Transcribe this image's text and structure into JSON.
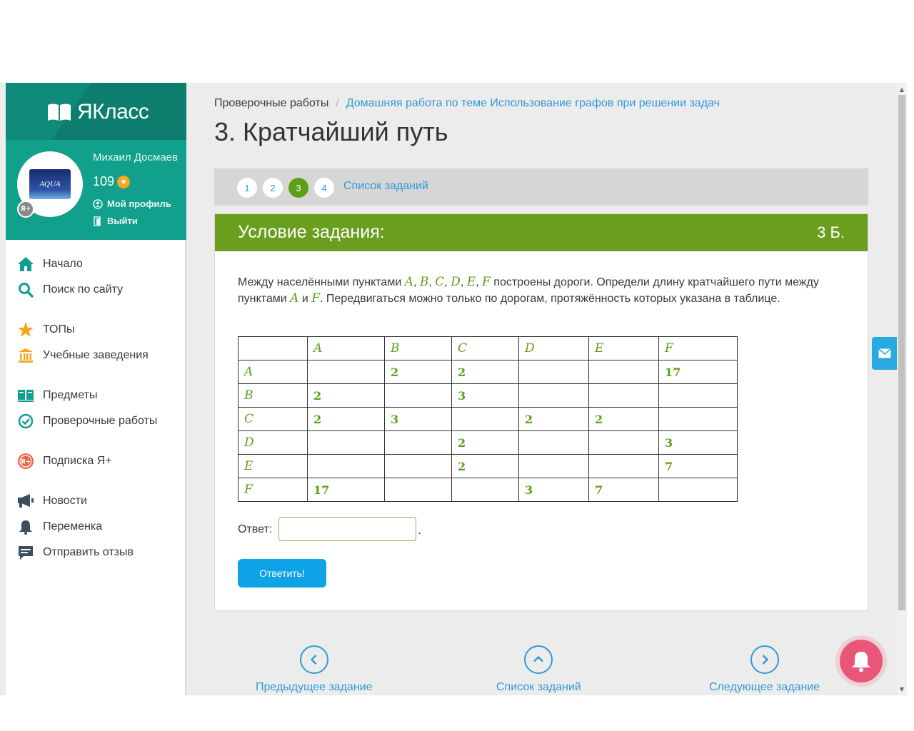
{
  "sidebar": {
    "logo_text": "ЯКласс",
    "avatar_text": "AQUA",
    "avatar_badge": "Я+",
    "user_name": "Михаил Досмаев",
    "points": "109",
    "profile_link": "Мой профиль",
    "logout_link": "Выйти",
    "nav": [
      {
        "label": "Начало",
        "icon": "home-icon"
      },
      {
        "label": "Поиск по сайту",
        "icon": "search-icon"
      },
      {
        "label": "ТОПы",
        "icon": "star-icon"
      },
      {
        "label": "Учебные заведения",
        "icon": "institution-icon"
      },
      {
        "label": "Предметы",
        "icon": "books-icon"
      },
      {
        "label": "Проверочные работы",
        "icon": "check-circle-icon"
      },
      {
        "label": "Подписка Я+",
        "icon": "subscription-icon"
      },
      {
        "label": "Новости",
        "icon": "megaphone-icon"
      },
      {
        "label": "Переменка",
        "icon": "bell-icon"
      },
      {
        "label": "Отправить отзыв",
        "icon": "feedback-icon"
      }
    ]
  },
  "breadcrumb": {
    "root": "Проверочные работы",
    "separator": "/",
    "current": "Домашняя работа по теме Использование графов при решении задач"
  },
  "page_title": "3. Кратчайший путь",
  "pager": {
    "pages": [
      "1",
      "2",
      "3",
      "4"
    ],
    "active_page": "3",
    "task_list": "Список заданий"
  },
  "task": {
    "header": "Условие задания:",
    "points": "3 Б.",
    "text_1": "Между населёнными пунктами ",
    "points_list": [
      {
        "name": "A",
        "sep": ", "
      },
      {
        "name": "B",
        "sep": ", "
      },
      {
        "name": "C",
        "sep": ", "
      },
      {
        "name": "D",
        "sep": ", "
      },
      {
        "name": "E",
        "sep": ", "
      },
      {
        "name": "F",
        "sep": ""
      }
    ],
    "text_2": " построены дороги. Определи длину кратчайшего пути между пунктами ",
    "from": "A",
    "text_3": " и ",
    "to": "F",
    "text_4": ". Передвигаться можно только по дорогам, протяжённость которых указана в таблице.",
    "table": {
      "columns": [
        "",
        "A",
        "B",
        "C",
        "D",
        "E",
        "F"
      ],
      "rows": [
        [
          "A",
          "",
          "2",
          "2",
          "",
          "",
          "17"
        ],
        [
          "B",
          "2",
          "",
          "3",
          "",
          "",
          ""
        ],
        [
          "C",
          "2",
          "3",
          "",
          "2",
          "2",
          ""
        ],
        [
          "D",
          "",
          "",
          "2",
          "",
          "",
          "3"
        ],
        [
          "E",
          "",
          "",
          "2",
          "",
          "",
          "7"
        ],
        [
          "F",
          "17",
          "",
          "",
          "3",
          "7",
          ""
        ]
      ]
    },
    "answer_label": "Ответ:",
    "answer_value": "",
    "answer_suffix": ".",
    "submit": "Ответить!"
  },
  "bottom_nav": {
    "prev": "Предыдущее задание",
    "list": "Список заданий",
    "next": "Следующее задание"
  },
  "colors": {
    "brand": "#11a08c",
    "accent_green": "#6a9e1e",
    "link": "#2f9bd6",
    "submit": "#0ea2e6",
    "bell": "#ea5677"
  }
}
